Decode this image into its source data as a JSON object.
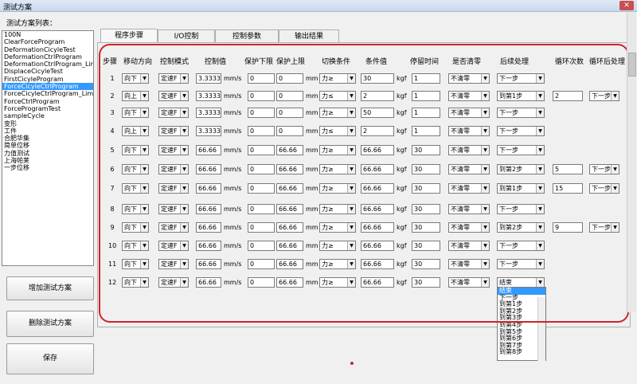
{
  "window": {
    "title": "测试方案"
  },
  "program_list": {
    "label": "测试方案列表：",
    "items": [
      "100N",
      "ClearForceProgram",
      "DeformationCicyleTest",
      "DeformationCtrlProgram",
      "DeformationCtrlProgram_Limit",
      "DisplaceCicyleTest",
      "FirstCicyleProgram",
      "ForceCicyleCtrlProgram",
      "ForceCicyleCtrlProgram_Limit",
      "ForceCtrlProgram",
      "ForceProgramTest",
      "sampleCycle",
      "变形",
      "工件",
      "合肥华集",
      "简单位移",
      "力值测试",
      "上海帕莱",
      "一步位移"
    ],
    "selected_index": 7
  },
  "buttons": {
    "add": "增加测试方案",
    "delete": "删除测试方案",
    "save": "保存"
  },
  "tabs": [
    "程序步骤",
    "I/O控制",
    "控制参数",
    "输出结果"
  ],
  "headers": {
    "step": "步骤",
    "direction": "移动方向",
    "mode": "控制模式",
    "value": "控制值",
    "prot_low": "保护下限",
    "prot_high": "保护上限",
    "switch": "切换条件",
    "cond_val": "条件值",
    "dwell": "停留时间",
    "clear": "是否清零",
    "next": "后续处理",
    "loops": "循环次数",
    "after_loop": "循环后处理"
  },
  "units": {
    "speed": "mm/s",
    "length": "mm",
    "force": "kgf"
  },
  "rows": [
    {
      "n": "1",
      "dir": "向下",
      "mode": "定速F",
      "val": "3.33333",
      "low": "0",
      "high": "0",
      "sw": "力≥",
      "cv": "30",
      "dw": "1",
      "clr": "不清零",
      "nx": "下一步",
      "lp": "",
      "al": ""
    },
    {
      "n": "2",
      "dir": "向上",
      "mode": "定速F",
      "val": "3.33333",
      "low": "0",
      "high": "0",
      "sw": "力≤",
      "cv": "2",
      "dw": "1",
      "clr": "不清零",
      "nx": "到第1步",
      "lp": "2",
      "al": "下一步"
    },
    {
      "n": "3",
      "dir": "向下",
      "mode": "定速F",
      "val": "3.33333",
      "low": "0",
      "high": "0",
      "sw": "力≥",
      "cv": "50",
      "dw": "1",
      "clr": "不清零",
      "nx": "下一步",
      "lp": "",
      "al": ""
    },
    {
      "n": "4",
      "dir": "向上",
      "mode": "定速F",
      "val": "3.33333",
      "low": "0",
      "high": "0",
      "sw": "力≤",
      "cv": "2",
      "dw": "1",
      "clr": "不清零",
      "nx": "下一步",
      "lp": "",
      "al": ""
    },
    {
      "n": "5",
      "dir": "向下",
      "mode": "定速F",
      "val": "66.66",
      "low": "0",
      "high": "66.66",
      "sw": "力≥",
      "cv": "66.66",
      "dw": "30",
      "clr": "不清零",
      "nx": "下一步",
      "lp": "",
      "al": ""
    },
    {
      "n": "6",
      "dir": "向下",
      "mode": "定速F",
      "val": "66.66",
      "low": "0",
      "high": "66.66",
      "sw": "力≥",
      "cv": "66.66",
      "dw": "30",
      "clr": "不清零",
      "nx": "到第2步",
      "lp": "5",
      "al": "下一步"
    },
    {
      "n": "7",
      "dir": "向下",
      "mode": "定速F",
      "val": "66.66",
      "low": "0",
      "high": "66.66",
      "sw": "力≥",
      "cv": "66.66",
      "dw": "30",
      "clr": "不清零",
      "nx": "到第1步",
      "lp": "15",
      "al": "下一步"
    },
    {
      "n": "8",
      "dir": "向下",
      "mode": "定速F",
      "val": "66.66",
      "low": "0",
      "high": "66.66",
      "sw": "力≥",
      "cv": "66.66",
      "dw": "30",
      "clr": "不清零",
      "nx": "下一步",
      "lp": "",
      "al": ""
    },
    {
      "n": "9",
      "dir": "向下",
      "mode": "定速F",
      "val": "66.66",
      "low": "0",
      "high": "66.66",
      "sw": "力≥",
      "cv": "66.66",
      "dw": "30",
      "clr": "不清零",
      "nx": "到第2步",
      "lp": "9",
      "al": "下一步"
    },
    {
      "n": "10",
      "dir": "向下",
      "mode": "定速F",
      "val": "66.66",
      "low": "0",
      "high": "66.66",
      "sw": "力≥",
      "cv": "66.66",
      "dw": "30",
      "clr": "不清零",
      "nx": "下一步",
      "lp": "",
      "al": ""
    },
    {
      "n": "11",
      "dir": "向下",
      "mode": "定速F",
      "val": "66.66",
      "low": "0",
      "high": "66.66",
      "sw": "力≥",
      "cv": "66.66",
      "dw": "30",
      "clr": "不清零",
      "nx": "下一步",
      "lp": "",
      "al": ""
    },
    {
      "n": "12",
      "dir": "向下",
      "mode": "定速F",
      "val": "66.66",
      "low": "0",
      "high": "66.66",
      "sw": "力≥",
      "cv": "66.66",
      "dw": "30",
      "clr": "不清零",
      "nx": "结束",
      "lp": "",
      "al": ""
    }
  ],
  "dropdown_options": [
    "结束",
    "下一步",
    "到第1步",
    "到第2步",
    "到第3步",
    "到第4步",
    "到第5步",
    "到第6步",
    "到第7步",
    "到第8步"
  ],
  "dropdown_highlight": 0,
  "colors": {
    "highlight_box": "#d2232a",
    "selection": "#3399ff"
  }
}
